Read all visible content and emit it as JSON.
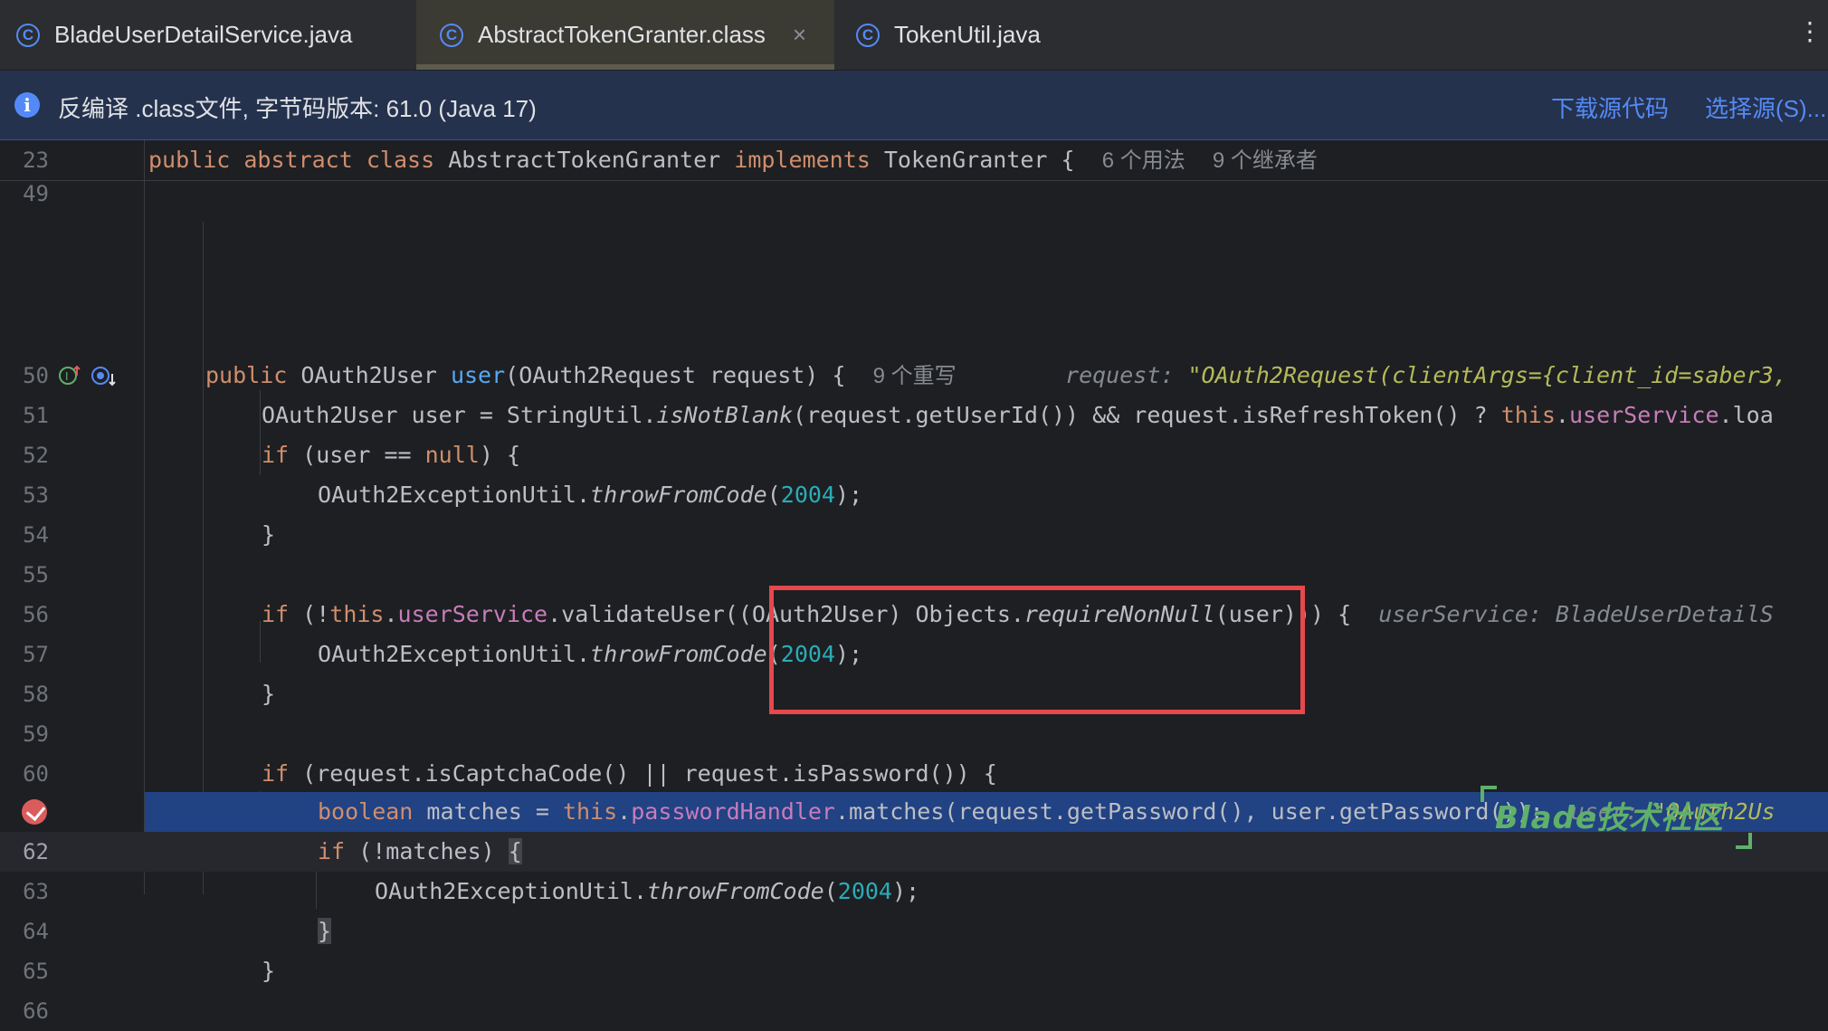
{
  "tabs": [
    {
      "label": "BladeUserDetailService.java",
      "icon": "class-icon",
      "active": false
    },
    {
      "label": "AbstractTokenGranter.class",
      "icon": "class-icon",
      "active": true,
      "close": "×"
    },
    {
      "label": "TokenUtil.java",
      "icon": "class-icon",
      "active": false
    }
  ],
  "banner": {
    "text": "反编译 .class文件, 字节码版本: 61.0 (Java 17)",
    "download_link": "下载源代码",
    "choose_link": "选择源(S)..."
  },
  "editor": {
    "sticky": {
      "line": "23",
      "parts": [
        "public",
        "abstract",
        "class",
        "AbstractTokenGranter",
        "implements",
        "TokenGranter {"
      ],
      "hint_usages": "6 个用法",
      "hint_inheritors": "9 个继承者"
    },
    "lines": {
      "l49": "49",
      "l50": "50",
      "l51": "51",
      "l52": "52",
      "l53": "53",
      "l54": "54",
      "l55": "55",
      "l56": "56",
      "l57": "57",
      "l58": "58",
      "l59": "59",
      "l60": "60",
      "l62": "62",
      "l63": "63",
      "l64": "64",
      "l65": "65",
      "l66": "66"
    },
    "code": {
      "l50_kw": "public",
      "l50_type": "OAuth2User",
      "l50_fn": "user",
      "l50_params": "(OAuth2Request request) {",
      "l50_hint": "9 个重写",
      "l50_inline_label": "request:",
      "l50_inline_value": "\"OAuth2Request(clientArgs={client_id=saber3,",
      "l51_a": "OAuth2User user = StringUtil.",
      "l51_b": "isNotBlank",
      "l51_c": "(request.getUserId()) && request.isRefreshToken() ? ",
      "l51_d": "this",
      "l51_e": ".",
      "l51_f": "userService",
      "l51_g": ".loa",
      "l52_kw": "if",
      "l52_a": " (user == ",
      "l52_null": "null",
      "l52_b": ") {",
      "throw_cls": "OAuth2ExceptionUtil.",
      "throw_fn": "throwFromCode",
      "throw_open": "(",
      "throw_num": "2004",
      "throw_close": ");",
      "brace": "}",
      "l56_kw": "if",
      "l56_a": " (!",
      "l56_this": "this",
      "l56_dot": ".",
      "l56_fld": "userService",
      "l56_b": ".validateUser((OAuth2User) Objects.",
      "l56_fn": "requireNonNull",
      "l56_c": "(user))) {",
      "l56_inline": "userService: BladeUserDetailS",
      "l60_kw": "if",
      "l60_a": " (request.isCaptchaCode() || request.isPassword()) {",
      "l61_kw": "boolean",
      "l61_a": " matches = ",
      "l61_this": "this",
      "l61_dot": ".",
      "l61_fld": "passwordHandler",
      "l61_b": ".matches(request.getPassword(), user.getPassword());",
      "l61_inline_label": "user:",
      "l61_inline_value": "\"OAuth2Us",
      "l62_kw": "if",
      "l62_a": " (!matches) ",
      "l62_brace": "{",
      "l64_brace": "}",
      "l65_brace": "}"
    }
  },
  "watermark": {
    "text": "Blade技术社区"
  },
  "colors": {
    "accent": "#548af7",
    "keyword": "#cf8e6d",
    "highlight": "#214283",
    "annotation": "#e5484d"
  }
}
